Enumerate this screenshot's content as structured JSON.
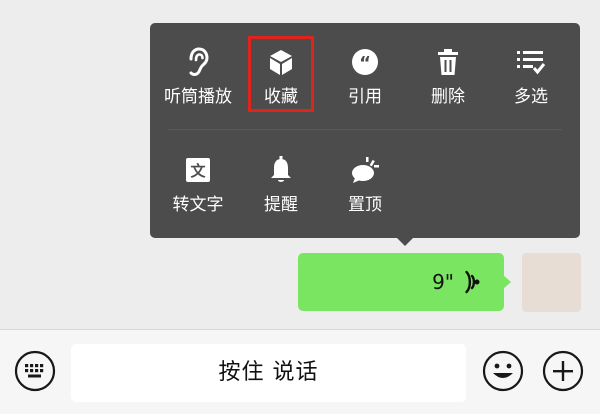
{
  "popup_menu": {
    "row1": [
      {
        "label": "听筒播放",
        "icon": "ear-icon"
      },
      {
        "label": "收藏",
        "icon": "cube-icon",
        "highlighted": true
      },
      {
        "label": "引用",
        "icon": "quote-icon"
      },
      {
        "label": "删除",
        "icon": "trash-icon"
      },
      {
        "label": "多选",
        "icon": "multiselect-icon"
      }
    ],
    "row2": [
      {
        "label": "转文字",
        "icon": "text-convert-icon"
      },
      {
        "label": "提醒",
        "icon": "bell-icon"
      },
      {
        "label": "置顶",
        "icon": "pin-top-icon"
      }
    ]
  },
  "voice_message": {
    "duration": "9\"",
    "icon": "voice-wave-icon"
  },
  "input_bar": {
    "keyboard_icon": "keyboard-icon",
    "hold_to_talk_label": "按住 说话",
    "emoji_icon": "emoji-icon",
    "plus_icon": "plus-circle-icon"
  },
  "colors": {
    "popup_bg": "#4c4c4c",
    "bubble_green": "#79e560",
    "highlight_red": "#e0231b",
    "chat_bg": "#ededed"
  }
}
